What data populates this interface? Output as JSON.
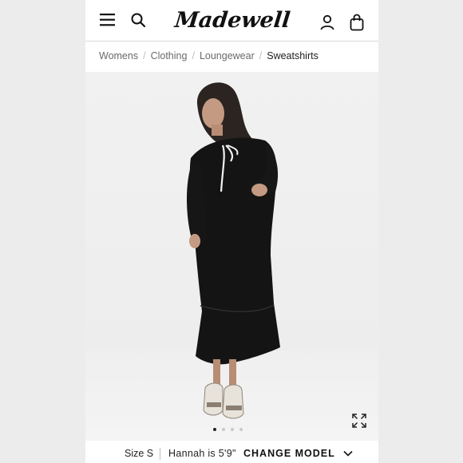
{
  "header": {
    "logo_text": "Madewell",
    "icons": [
      "menu-icon",
      "search-icon",
      "account-icon",
      "bag-icon"
    ]
  },
  "breadcrumb": {
    "items": [
      "Womens",
      "Clothing",
      "Loungewear",
      "Sweatshirts"
    ],
    "separator": "/"
  },
  "gallery": {
    "slide_count": 4,
    "active_index": 0
  },
  "size_bar": {
    "size": "Size S",
    "model_height": "Hannah is 5'9\"",
    "change_model_label": "CHANGE MODEL"
  },
  "colors": {
    "background": "#ececec",
    "garment": "#141414",
    "text": "#222222"
  }
}
